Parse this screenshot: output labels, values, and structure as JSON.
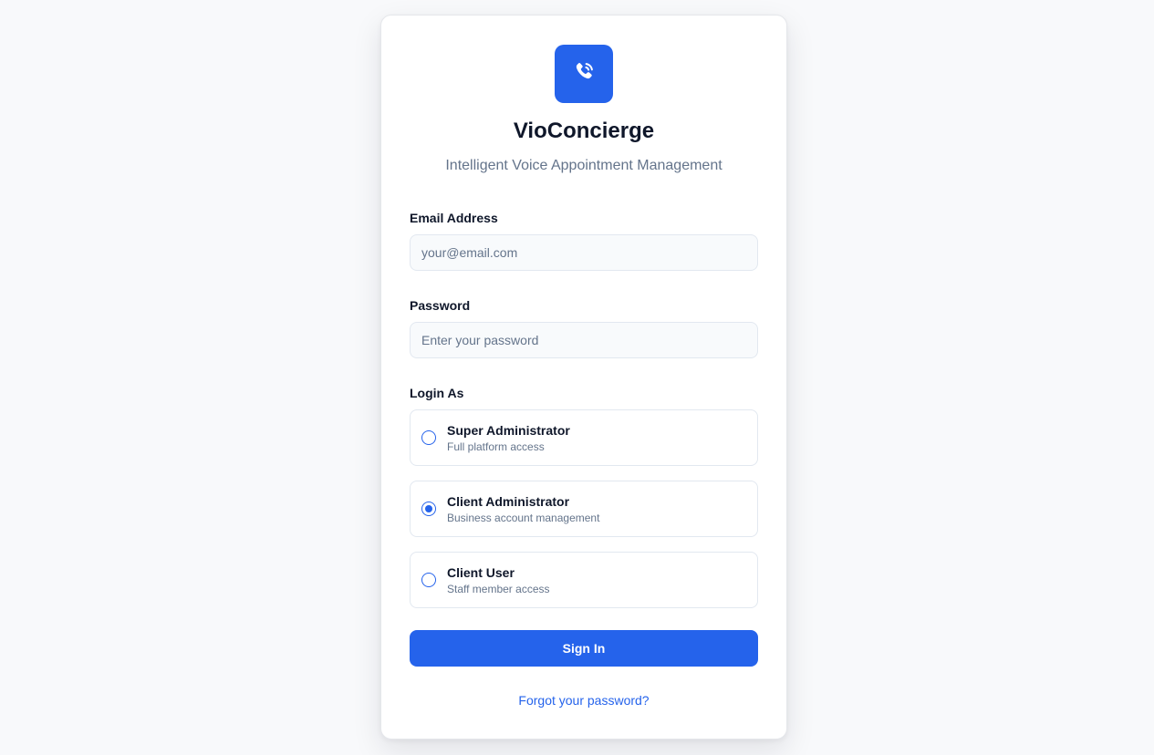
{
  "brand": {
    "logo_icon": "phone-call-icon",
    "accent_color": "#2563eb",
    "title": "VioConcierge",
    "subtitle": "Intelligent Voice Appointment Management"
  },
  "form": {
    "email": {
      "label": "Email Address",
      "placeholder": "your@email.com",
      "value": ""
    },
    "password": {
      "label": "Password",
      "placeholder": "Enter your password",
      "value": ""
    },
    "login_as": {
      "label": "Login As",
      "selected": "Client Administrator",
      "options": [
        {
          "title": "Super Administrator",
          "description": "Full platform access",
          "checked": false
        },
        {
          "title": "Client Administrator",
          "description": "Business account management",
          "checked": true
        },
        {
          "title": "Client User",
          "description": "Staff member access",
          "checked": false
        }
      ]
    },
    "submit_label": "Sign In",
    "forgot_link": "Forgot your password?"
  }
}
